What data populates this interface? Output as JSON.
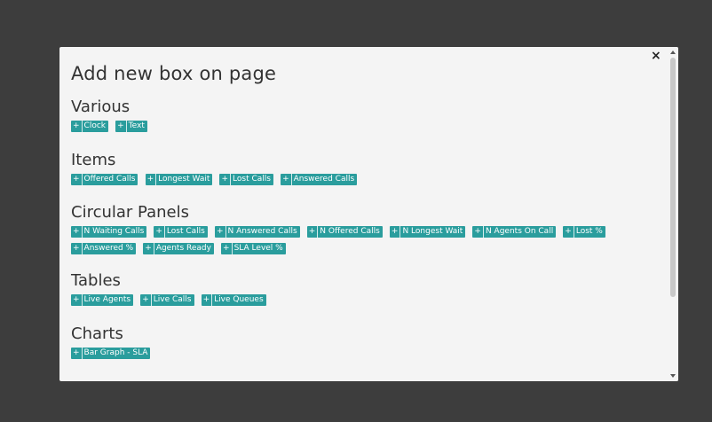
{
  "modal": {
    "title": "Add new box on page",
    "close_glyph": "×"
  },
  "sections": [
    {
      "title": "Various",
      "items": [
        "Clock",
        "Text"
      ]
    },
    {
      "title": "Items",
      "items": [
        "Offered Calls",
        "Longest Wait",
        "Lost Calls",
        "Answered Calls"
      ]
    },
    {
      "title": "Circular Panels",
      "items": [
        "N Waiting Calls",
        "Lost Calls",
        "N Answered Calls",
        "N Offered Calls",
        "N Longest Wait",
        "N Agents On Call",
        "Lost %",
        "Answered %",
        "Agents Ready",
        "SLA Level %"
      ]
    },
    {
      "title": "Tables",
      "items": [
        "Live Agents",
        "Live Calls",
        "Live Queues"
      ]
    },
    {
      "title": "Charts",
      "items": [
        "Bar Graph - SLA"
      ]
    }
  ],
  "plus_glyph": "+",
  "icons": {
    "close": "close-icon",
    "scroll_up": "chevron-up-icon",
    "scroll_down": "chevron-down-icon"
  },
  "colors": {
    "backdrop": "#3d3d3d",
    "modal_bg": "#f4f4f4",
    "button_bg": "#2a9d9d",
    "button_text": "#ffffff"
  }
}
